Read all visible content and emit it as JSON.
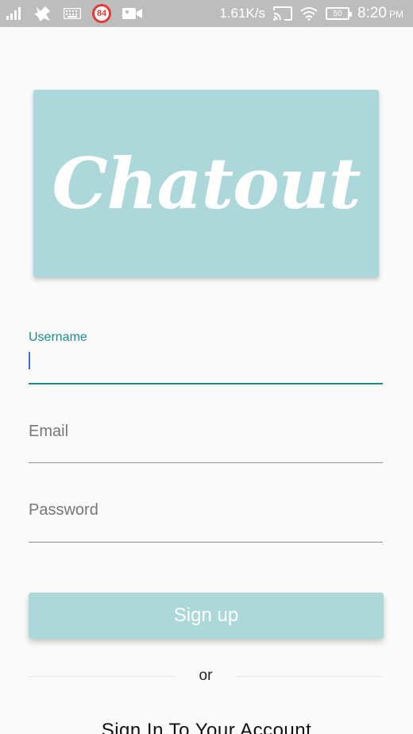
{
  "status_bar": {
    "notification_count": "84",
    "network_speed": "1.61K/s",
    "battery_level": "50",
    "time": "8:20",
    "time_suffix": "PM"
  },
  "logo": {
    "text": "Chatout",
    "background_color": "#acd8da"
  },
  "form": {
    "username": {
      "label": "Username",
      "value": ""
    },
    "email": {
      "placeholder": "Email",
      "value": ""
    },
    "password": {
      "placeholder": "Password",
      "value": ""
    }
  },
  "actions": {
    "signup_label": "Sign up",
    "divider_text": "or",
    "signin_link": "Sign In To Your Account"
  },
  "colors": {
    "accent": "#188b8b",
    "button": "#acd8da"
  }
}
